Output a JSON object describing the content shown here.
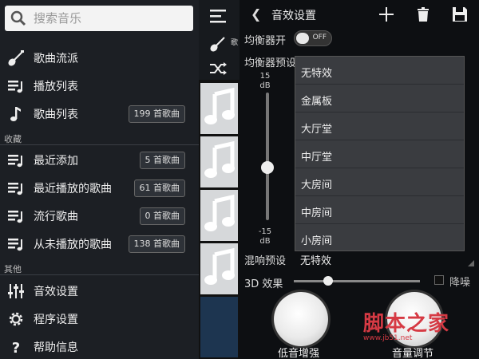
{
  "left_drawer": {
    "search_placeholder": "搜索音乐",
    "items": [
      {
        "label": "歌曲流派",
        "icon": "guitar-icon",
        "badge": ""
      },
      {
        "label": "播放列表",
        "icon": "playlist-icon",
        "badge": ""
      },
      {
        "label": "歌曲列表",
        "icon": "music-note-icon",
        "badge": "199 首歌曲"
      }
    ],
    "section_favorites": "收藏",
    "favorites": [
      {
        "label": "最近添加",
        "badge": "5 首歌曲"
      },
      {
        "label": "最近播放的歌曲",
        "badge": "61 首歌曲"
      },
      {
        "label": "流行歌曲",
        "badge": "0 首歌曲"
      },
      {
        "label": "从未播放的歌曲",
        "badge": "138 首歌曲"
      }
    ],
    "section_other": "其他",
    "other": [
      {
        "label": "音效设置",
        "icon": "equalizer-icon"
      },
      {
        "label": "程序设置",
        "icon": "gear-icon"
      },
      {
        "label": "帮助信息",
        "icon": "help-icon"
      }
    ]
  },
  "strip": {
    "label_1": "歌",
    "thumb_icon": "music-note-icon"
  },
  "right_panel": {
    "title": "音效设置",
    "eq_label": "均衡器开",
    "toggle_text": "OFF",
    "eq_enabled": false,
    "preset_label": "均衡器预设",
    "db_top": "15",
    "db_unit": "dB",
    "db_bottom": "-15",
    "slider_level": 0.5,
    "preset_options": [
      "无特效",
      "金属板",
      "大厅堂",
      "中厅堂",
      "大房间",
      "中房间",
      "小房间"
    ],
    "reverb_label": "混响预设",
    "reverb_value": "无特效",
    "fx3d_label": "3D 效果",
    "fx3d_level": 0.27,
    "noise_label": "降噪",
    "bass_label": "低音增强",
    "volume_label": "音量调节"
  },
  "watermark": {
    "text": "脚本之家",
    "url": "www.jb51.net"
  },
  "colors": {
    "accent": "#d63a44",
    "panel": "#1c1f24"
  }
}
